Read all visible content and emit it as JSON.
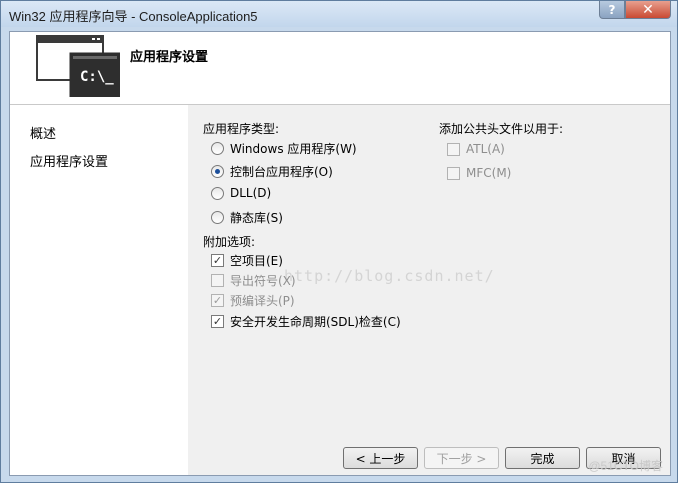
{
  "window": {
    "title": "Win32 应用程序向导 - ConsoleApplication5",
    "help_label": "?",
    "close_label": "✕"
  },
  "header": {
    "title": "应用程序设置",
    "icon_text": "C:\\_",
    "icon_name": "console-app-icon"
  },
  "sidebar": {
    "items": [
      {
        "label": "概述"
      },
      {
        "label": "应用程序设置"
      }
    ]
  },
  "app_type": {
    "label": "应用程序类型:",
    "options": [
      {
        "label": "Windows 应用程序(W)",
        "selected": false
      },
      {
        "label": "控制台应用程序(O)",
        "selected": true
      },
      {
        "label": "DLL(D)",
        "selected": false
      },
      {
        "label": "静态库(S)",
        "selected": false
      }
    ]
  },
  "extra_options": {
    "label": "附加选项:",
    "options": [
      {
        "label": "空项目(E)",
        "checked": true,
        "enabled": true
      },
      {
        "label": "导出符号(X)",
        "checked": false,
        "enabled": false
      },
      {
        "label": "预编译头(P)",
        "checked": true,
        "enabled": false
      },
      {
        "label": "安全开发生命周期(SDL)检查(C)",
        "checked": true,
        "enabled": true
      }
    ]
  },
  "common_headers": {
    "label": "添加公共头文件以用于:",
    "options": [
      {
        "label": "ATL(A)",
        "checked": false,
        "enabled": false
      },
      {
        "label": "MFC(M)",
        "checked": false,
        "enabled": false
      }
    ]
  },
  "watermark": "http://blog.csdn.net/",
  "buttons": {
    "prev": "< 上一步",
    "next": "下一步 >",
    "finish": "完成",
    "cancel": "取消"
  },
  "corner_watermark": "@51CTO博客",
  "colors": {
    "titlebar": "#c7d9ec",
    "selected_radio": "#1c4f9b",
    "close_button": "#c94a33"
  }
}
